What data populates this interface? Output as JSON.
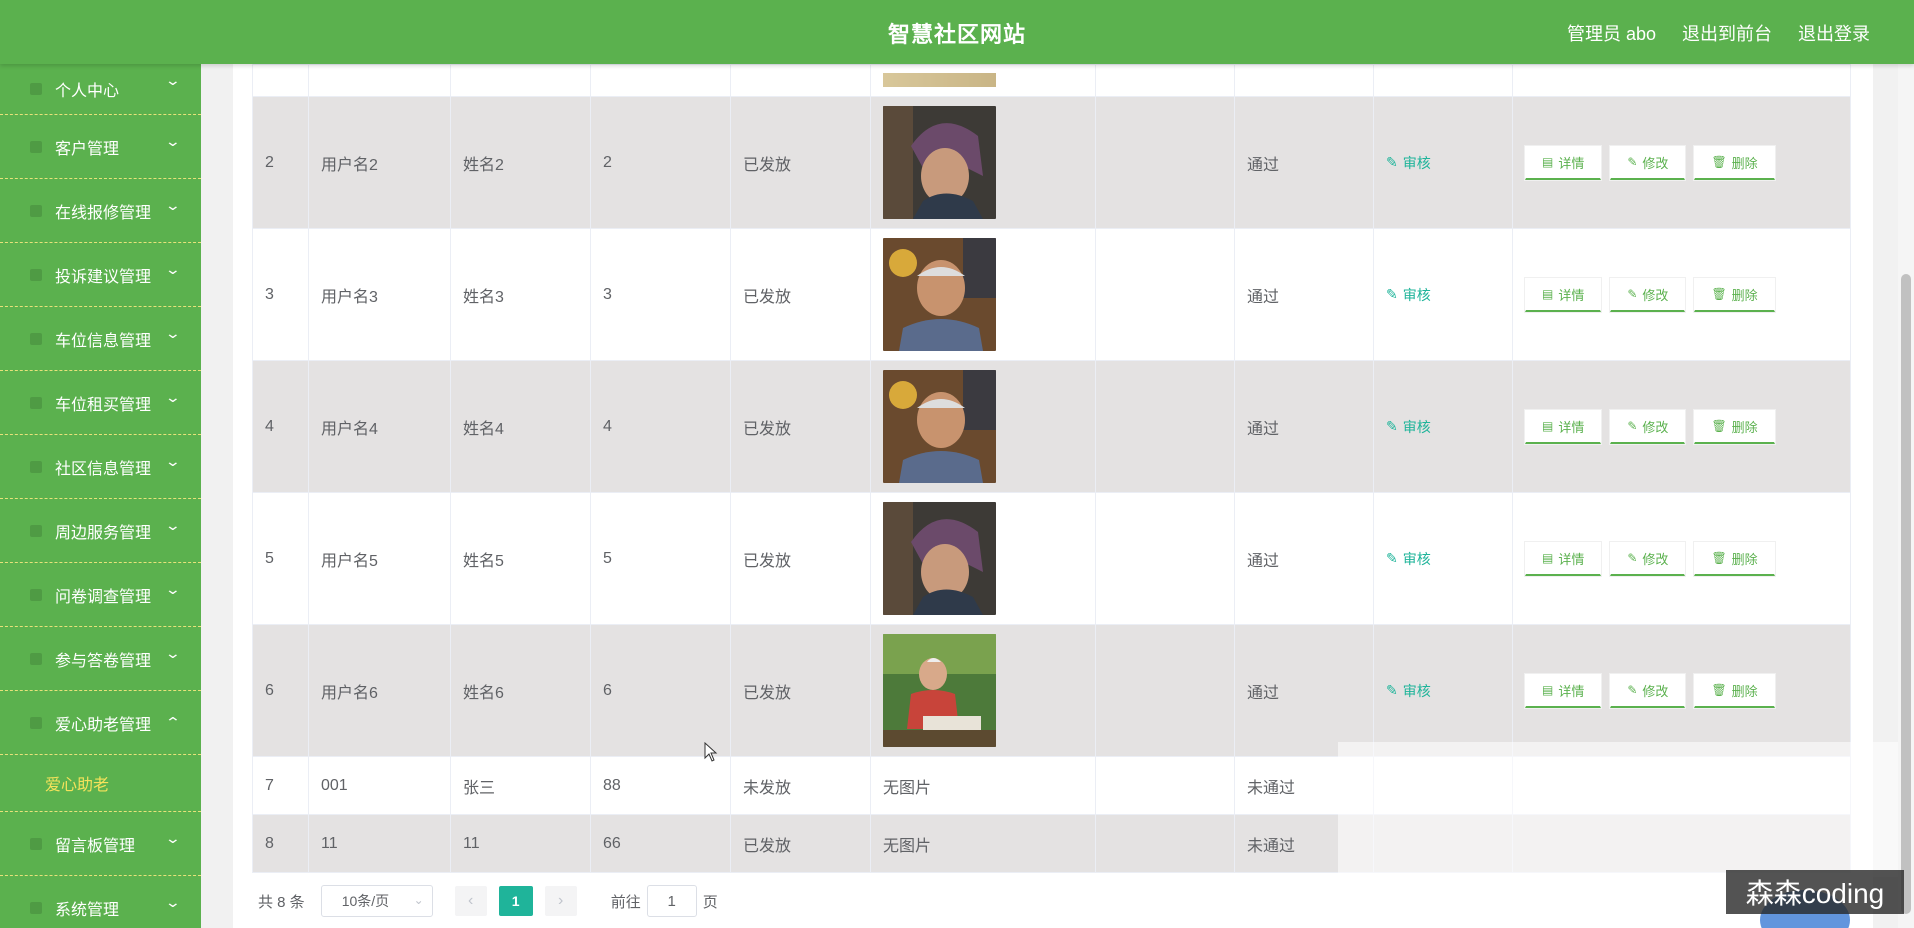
{
  "header": {
    "title": "智慧社区网站",
    "admin": "管理员 abo",
    "front": "退出到前台",
    "logout": "退出登录"
  },
  "sidebar": {
    "items": [
      {
        "label": "个人中心"
      },
      {
        "label": "客户管理"
      },
      {
        "label": "在线报修管理"
      },
      {
        "label": "投诉建议管理"
      },
      {
        "label": "车位信息管理"
      },
      {
        "label": "车位租买管理"
      },
      {
        "label": "社区信息管理"
      },
      {
        "label": "周边服务管理"
      },
      {
        "label": "问卷调查管理"
      },
      {
        "label": "参与答卷管理"
      },
      {
        "label": "爱心助老管理"
      }
    ],
    "sub_item": "爱心助老",
    "after_items": [
      {
        "label": "留言板管理"
      },
      {
        "label": "系统管理"
      }
    ]
  },
  "table": {
    "rows": [
      {
        "idx": "2",
        "user": "用户名2",
        "name": "姓名2",
        "num": "2",
        "status": "已发放",
        "photo": "woman-hood",
        "result": "通过"
      },
      {
        "idx": "3",
        "user": "用户名3",
        "name": "姓名3",
        "num": "3",
        "status": "已发放",
        "photo": "man-smile",
        "result": "通过"
      },
      {
        "idx": "4",
        "user": "用户名4",
        "name": "姓名4",
        "num": "4",
        "status": "已发放",
        "photo": "man-smile",
        "result": "通过"
      },
      {
        "idx": "5",
        "user": "用户名5",
        "name": "姓名5",
        "num": "5",
        "status": "已发放",
        "photo": "woman-hood",
        "result": "通过"
      },
      {
        "idx": "6",
        "user": "用户名6",
        "name": "姓名6",
        "num": "6",
        "status": "已发放",
        "photo": "man-park",
        "result": "通过"
      },
      {
        "idx": "7",
        "user": "001",
        "name": "张三",
        "num": "88",
        "status": "未发放",
        "photo_text": "无图片",
        "result": "未通过"
      },
      {
        "idx": "8",
        "user": "11",
        "name": "11",
        "num": "66",
        "status": "已发放",
        "photo_text": "无图片",
        "result": "未通过"
      }
    ],
    "audit_label": "审核",
    "detail_label": "详情",
    "edit_label": "修改",
    "delete_label": "删除"
  },
  "pager": {
    "total": "共 8 条",
    "page_size": "10条/页",
    "current": "1",
    "goto": "前往",
    "jump_value": "1",
    "page_suffix": "页"
  },
  "watermark": "森森coding",
  "colors": {
    "primary": "#5bb14e",
    "accent": "#1fb49a",
    "highlight": "#f5e25b"
  }
}
